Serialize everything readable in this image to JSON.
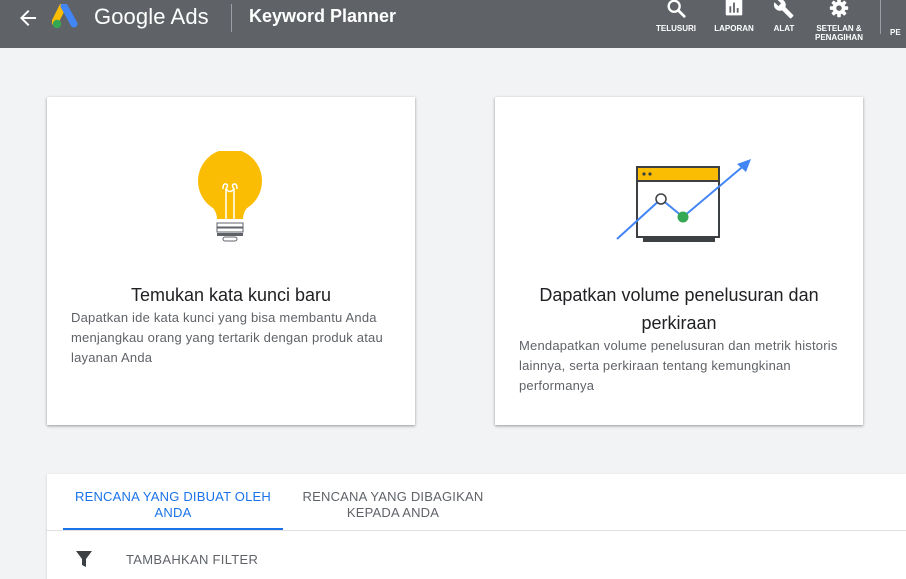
{
  "header": {
    "brand": "Google Ads",
    "product": "Keyword Planner",
    "tools": [
      {
        "label": "TELUSURI",
        "icon": "search-icon"
      },
      {
        "label": "LAPORAN",
        "icon": "bar-chart-icon"
      },
      {
        "label": "ALAT",
        "icon": "wrench-icon"
      },
      {
        "label": "SETELAN & PENAGIHAN",
        "icon": "gear-icon"
      },
      {
        "label": "PE",
        "icon": "account-icon"
      }
    ]
  },
  "cards": [
    {
      "title": "Temukan kata kunci baru",
      "desc": "Dapatkan ide kata kunci yang bisa membantu Anda menjangkau orang yang tertarik dengan produk atau layanan Anda",
      "icon": "lightbulb-icon"
    },
    {
      "title": "Dapatkan volume penelusuran dan perkiraan",
      "desc": "Mendapatkan volume penelusuran dan metrik historis lainnya, serta perkiraan tentang kemungkinan performanya",
      "icon": "trend-chart-icon"
    }
  ],
  "plans": {
    "tabs": [
      {
        "label": "RENCANA YANG DIBUAT OLEH ANDA",
        "active": true
      },
      {
        "label": "RENCANA YANG DIBAGIKAN KEPADA ANDA",
        "active": false
      }
    ],
    "filter_label": "TAMBAHKAN FILTER"
  },
  "colors": {
    "header_bg": "#5f6368",
    "accent": "#1a73e8",
    "bulb": "#fbbc04",
    "green": "#34a853"
  }
}
